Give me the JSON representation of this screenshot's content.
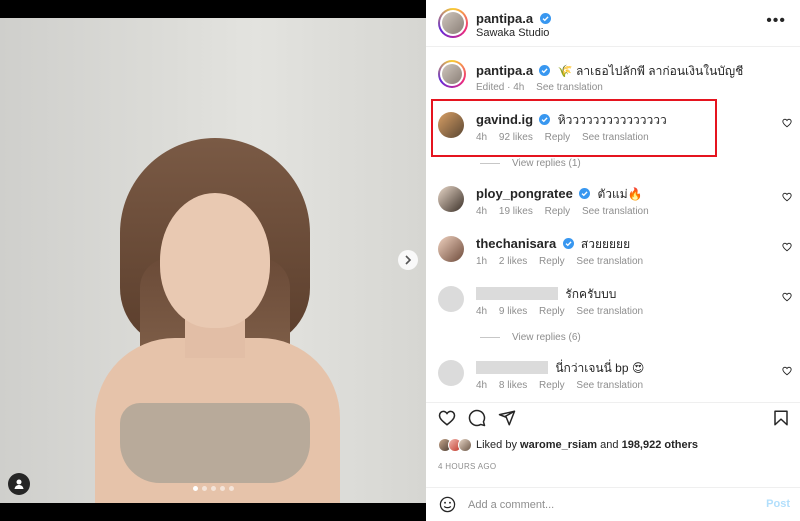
{
  "post": {
    "author": "pantipa.a",
    "location": "Sawaka Studio",
    "carousel": {
      "total_slides": 5,
      "active_slide": 1
    }
  },
  "caption": {
    "username": "pantipa.a",
    "text": "🌾 ลาเธอไปลักพี ลาก่อนเงินในบัญชี",
    "edited": "Edited · 4h",
    "see_translation": "See translation"
  },
  "comments": [
    {
      "username": "gavind.ig",
      "verified": true,
      "text": "หิววววววววววววววว",
      "time": "4h",
      "likes": "92 likes",
      "reply": "Reply",
      "translate": "See translation",
      "view_replies": "View replies (1)"
    },
    {
      "username": "ploy_pongratee",
      "verified": true,
      "text": "ตัวแม่🔥",
      "time": "4h",
      "likes": "19 likes",
      "reply": "Reply",
      "translate": "See translation"
    },
    {
      "username": "thechanisara",
      "verified": true,
      "text": "สวยยยยย",
      "time": "1h",
      "likes": "2 likes",
      "reply": "Reply",
      "translate": "See translation"
    },
    {
      "username": "",
      "verified": false,
      "text": "รักครับบบ",
      "time": "4h",
      "likes": "9 likes",
      "reply": "Reply",
      "translate": "See translation",
      "view_replies": "View replies (6)"
    },
    {
      "username": "",
      "verified": false,
      "text": "นี่กว่าเจนนี่ bp 😍",
      "time": "4h",
      "likes": "8 likes",
      "reply": "Reply",
      "translate": "See translation"
    }
  ],
  "likes": {
    "prefix": "Liked by",
    "first_user": "warome_rsiam",
    "connector": "and",
    "others": "198,922 others"
  },
  "time_ago": "4 HOURS AGO",
  "composer": {
    "placeholder": "Add a comment...",
    "post_label": "Post"
  },
  "colors": {
    "highlight_box": "#e5141f",
    "verified_blue": "#3897f0",
    "post_button": "#b2dffc"
  },
  "icons": {
    "header_more": "more-options-icon",
    "like": "heart-icon",
    "comment": "comment-icon",
    "share": "share-icon",
    "save": "bookmark-icon",
    "emoji": "emoji-icon"
  }
}
